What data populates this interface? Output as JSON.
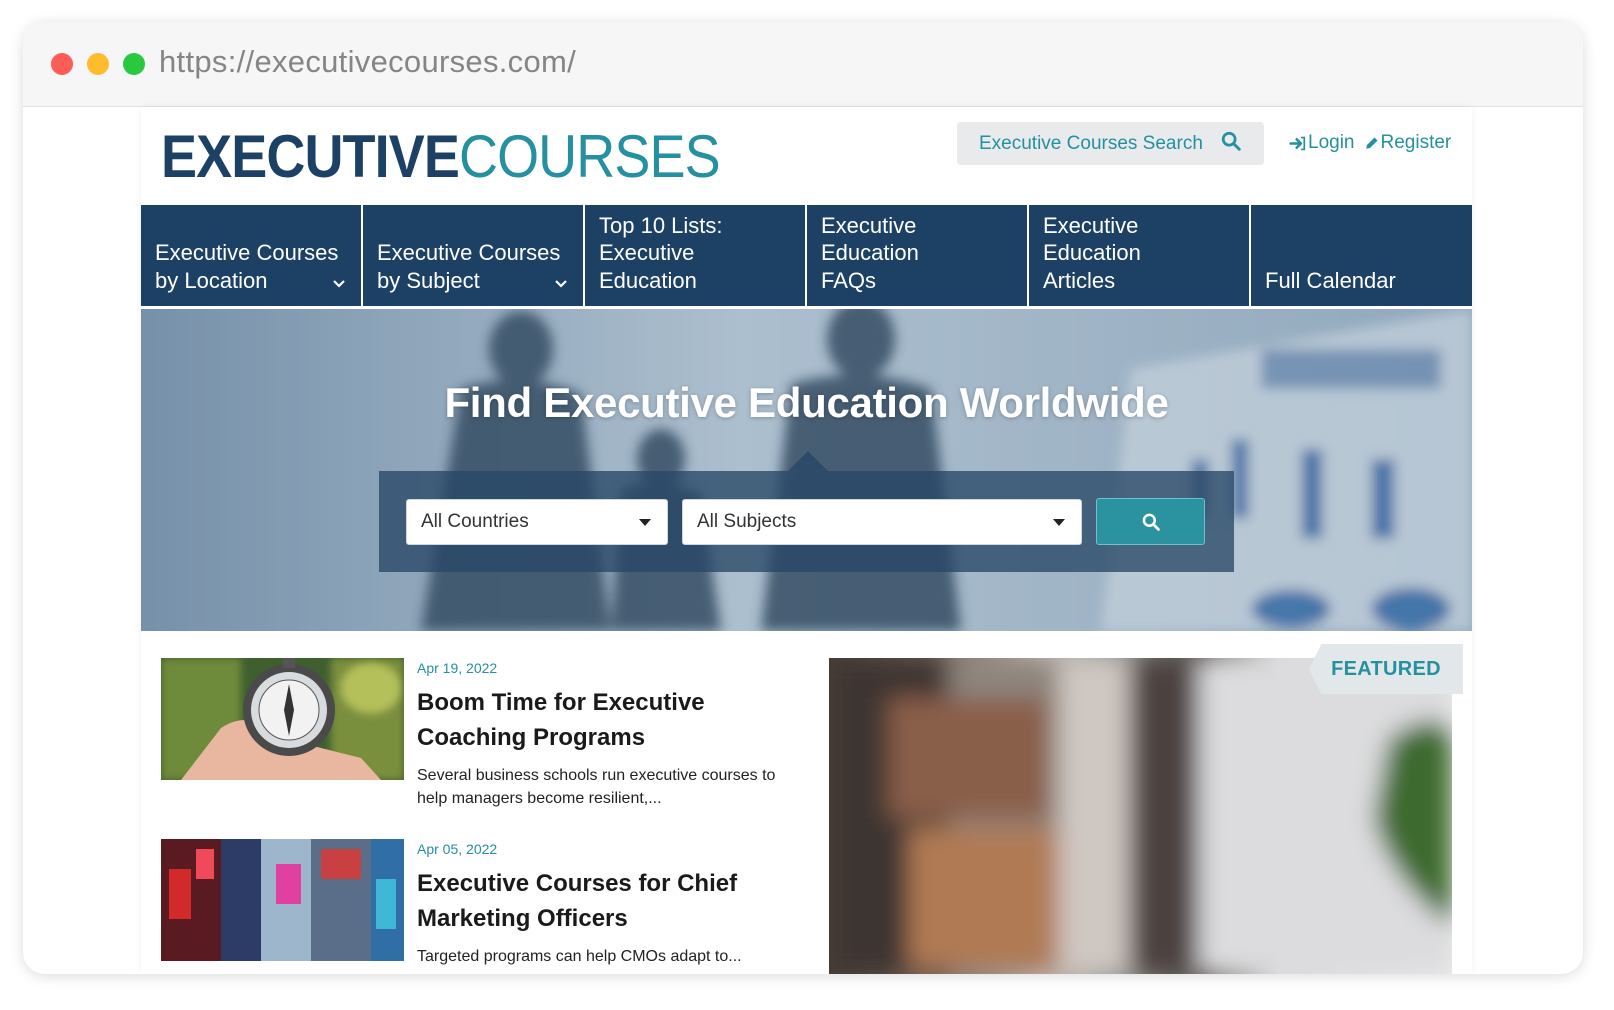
{
  "browser": {
    "url": "https://executivecourses.com/"
  },
  "header": {
    "logo_part1": "EXECUTIVE",
    "logo_part2": "COURSES",
    "search_label": "Executive Courses Search",
    "login_label": "Login",
    "register_label": "Register"
  },
  "nav": {
    "items": [
      {
        "label": "Executive Courses\nby Location",
        "has_dropdown": true
      },
      {
        "label": "Executive Courses\nby Subject",
        "has_dropdown": true
      },
      {
        "label": "Top 10 Lists:\nExecutive\nEducation",
        "has_dropdown": false
      },
      {
        "label": "Executive\nEducation\nFAQs",
        "has_dropdown": false
      },
      {
        "label": "Executive\nEducation\nArticles",
        "has_dropdown": false
      },
      {
        "label": "Full Calendar",
        "has_dropdown": false
      }
    ]
  },
  "hero": {
    "title": "Find Executive Education Worldwide",
    "country_select": "All Countries",
    "subject_select": "All Subjects"
  },
  "articles": [
    {
      "date": "Apr 19, 2022",
      "title": "Boom Time for Executive Coaching Programs",
      "excerpt": "Several business schools run executive courses to help managers become resilient,..."
    },
    {
      "date": "Apr 05, 2022",
      "title": "Executive Courses for Chief Marketing Officers",
      "excerpt": "Targeted programs can help CMOs adapt to..."
    }
  ],
  "featured": {
    "tag": "FEATURED"
  },
  "colors": {
    "navy": "#1d4165",
    "teal": "#25909f",
    "button": "#2b93a0"
  }
}
